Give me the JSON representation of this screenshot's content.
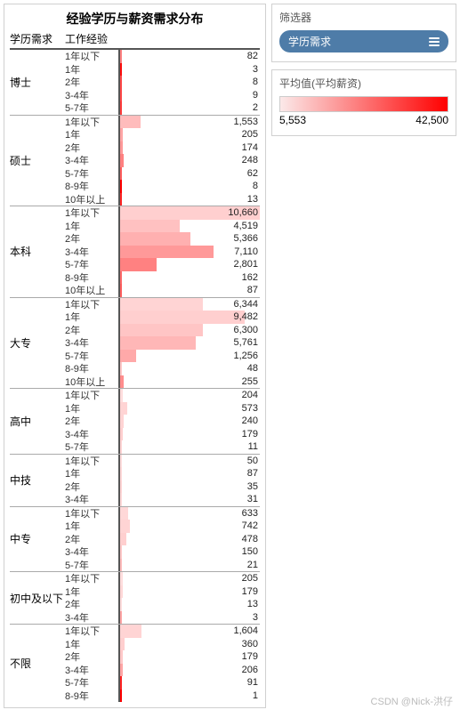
{
  "title": "经验学历与薪资需求分布",
  "headers": {
    "col1": "学历需求",
    "col2": "工作经验"
  },
  "filter": {
    "panel_title": "筛选器",
    "pill_label": "学历需求"
  },
  "legend": {
    "title": "平均值(平均薪资)",
    "min": "5,553",
    "max": "42,500"
  },
  "watermark": "CSDN @Nick-洪仔",
  "chart_data": {
    "type": "bar",
    "xlabel": "",
    "ylabel": "",
    "color_metric": "平均薪资",
    "color_range": [
      5553,
      42500
    ],
    "max_value": 10660,
    "groups": [
      {
        "name": "博士",
        "rows": [
          {
            "exp": "1年以下",
            "value": 82,
            "intensity": 0.45
          },
          {
            "exp": "1年",
            "value": 3,
            "intensity": 0.95
          },
          {
            "exp": "2年",
            "value": 8,
            "intensity": 0.7
          },
          {
            "exp": "3-4年",
            "value": 9,
            "intensity": 0.7
          },
          {
            "exp": "5-7年",
            "value": 2,
            "intensity": 0.75
          }
        ]
      },
      {
        "name": "硕士",
        "rows": [
          {
            "exp": "1年以下",
            "value": 1553,
            "intensity": 0.2
          },
          {
            "exp": "1年",
            "value": 205,
            "intensity": 0.3
          },
          {
            "exp": "2年",
            "value": 174,
            "intensity": 0.35
          },
          {
            "exp": "3-4年",
            "value": 248,
            "intensity": 0.45
          },
          {
            "exp": "5-7年",
            "value": 62,
            "intensity": 0.6
          },
          {
            "exp": "8-9年",
            "value": 8,
            "intensity": 1.0
          },
          {
            "exp": "10年以上",
            "value": 13,
            "intensity": 0.85
          }
        ]
      },
      {
        "name": "本科",
        "rows": [
          {
            "exp": "1年以下",
            "value": 10660,
            "intensity": 0.12
          },
          {
            "exp": "1年",
            "value": 4519,
            "intensity": 0.18
          },
          {
            "exp": "2年",
            "value": 5366,
            "intensity": 0.25
          },
          {
            "exp": "3-4年",
            "value": 7110,
            "intensity": 0.35
          },
          {
            "exp": "5-7年",
            "value": 2801,
            "intensity": 0.45
          },
          {
            "exp": "8-9年",
            "value": 162,
            "intensity": 0.55
          },
          {
            "exp": "10年以上",
            "value": 87,
            "intensity": 0.6
          }
        ]
      },
      {
        "name": "大专",
        "rows": [
          {
            "exp": "1年以下",
            "value": 6344,
            "intensity": 0.1
          },
          {
            "exp": "1年",
            "value": 9482,
            "intensity": 0.12
          },
          {
            "exp": "2年",
            "value": 6300,
            "intensity": 0.16
          },
          {
            "exp": "3-4年",
            "value": 5761,
            "intensity": 0.22
          },
          {
            "exp": "5-7年",
            "value": 1256,
            "intensity": 0.28
          },
          {
            "exp": "8-9年",
            "value": 48,
            "intensity": 0.15
          },
          {
            "exp": "10年以上",
            "value": 255,
            "intensity": 0.4
          }
        ]
      },
      {
        "name": "高中",
        "rows": [
          {
            "exp": "1年以下",
            "value": 204,
            "intensity": 0.06
          },
          {
            "exp": "1年",
            "value": 573,
            "intensity": 0.1
          },
          {
            "exp": "2年",
            "value": 240,
            "intensity": 0.1
          },
          {
            "exp": "3-4年",
            "value": 179,
            "intensity": 0.12
          },
          {
            "exp": "5-7年",
            "value": 11,
            "intensity": 0.1
          }
        ]
      },
      {
        "name": "中技",
        "rows": [
          {
            "exp": "1年以下",
            "value": 50,
            "intensity": 0.06
          },
          {
            "exp": "1年",
            "value": 87,
            "intensity": 0.08
          },
          {
            "exp": "2年",
            "value": 35,
            "intensity": 0.1
          },
          {
            "exp": "3-4年",
            "value": 31,
            "intensity": 0.08
          }
        ]
      },
      {
        "name": "中专",
        "rows": [
          {
            "exp": "1年以下",
            "value": 633,
            "intensity": 0.08
          },
          {
            "exp": "1年",
            "value": 742,
            "intensity": 0.1
          },
          {
            "exp": "2年",
            "value": 478,
            "intensity": 0.12
          },
          {
            "exp": "3-4年",
            "value": 150,
            "intensity": 0.15
          },
          {
            "exp": "5-7年",
            "value": 21,
            "intensity": 0.2
          }
        ]
      },
      {
        "name": "初中及以下",
        "rows": [
          {
            "exp": "1年以下",
            "value": 205,
            "intensity": 0.06
          },
          {
            "exp": "1年",
            "value": 179,
            "intensity": 0.08
          },
          {
            "exp": "2年",
            "value": 13,
            "intensity": 0.06
          },
          {
            "exp": "3-4年",
            "value": 3,
            "intensity": 0.3
          }
        ]
      },
      {
        "name": "不限",
        "rows": [
          {
            "exp": "1年以下",
            "value": 1604,
            "intensity": 0.1
          },
          {
            "exp": "1年",
            "value": 360,
            "intensity": 0.12
          },
          {
            "exp": "2年",
            "value": 179,
            "intensity": 0.15
          },
          {
            "exp": "3-4年",
            "value": 206,
            "intensity": 0.3
          },
          {
            "exp": "5-7年",
            "value": 91,
            "intensity": 0.85
          },
          {
            "exp": "8-9年",
            "value": 1,
            "intensity": 1.0
          }
        ]
      }
    ]
  }
}
